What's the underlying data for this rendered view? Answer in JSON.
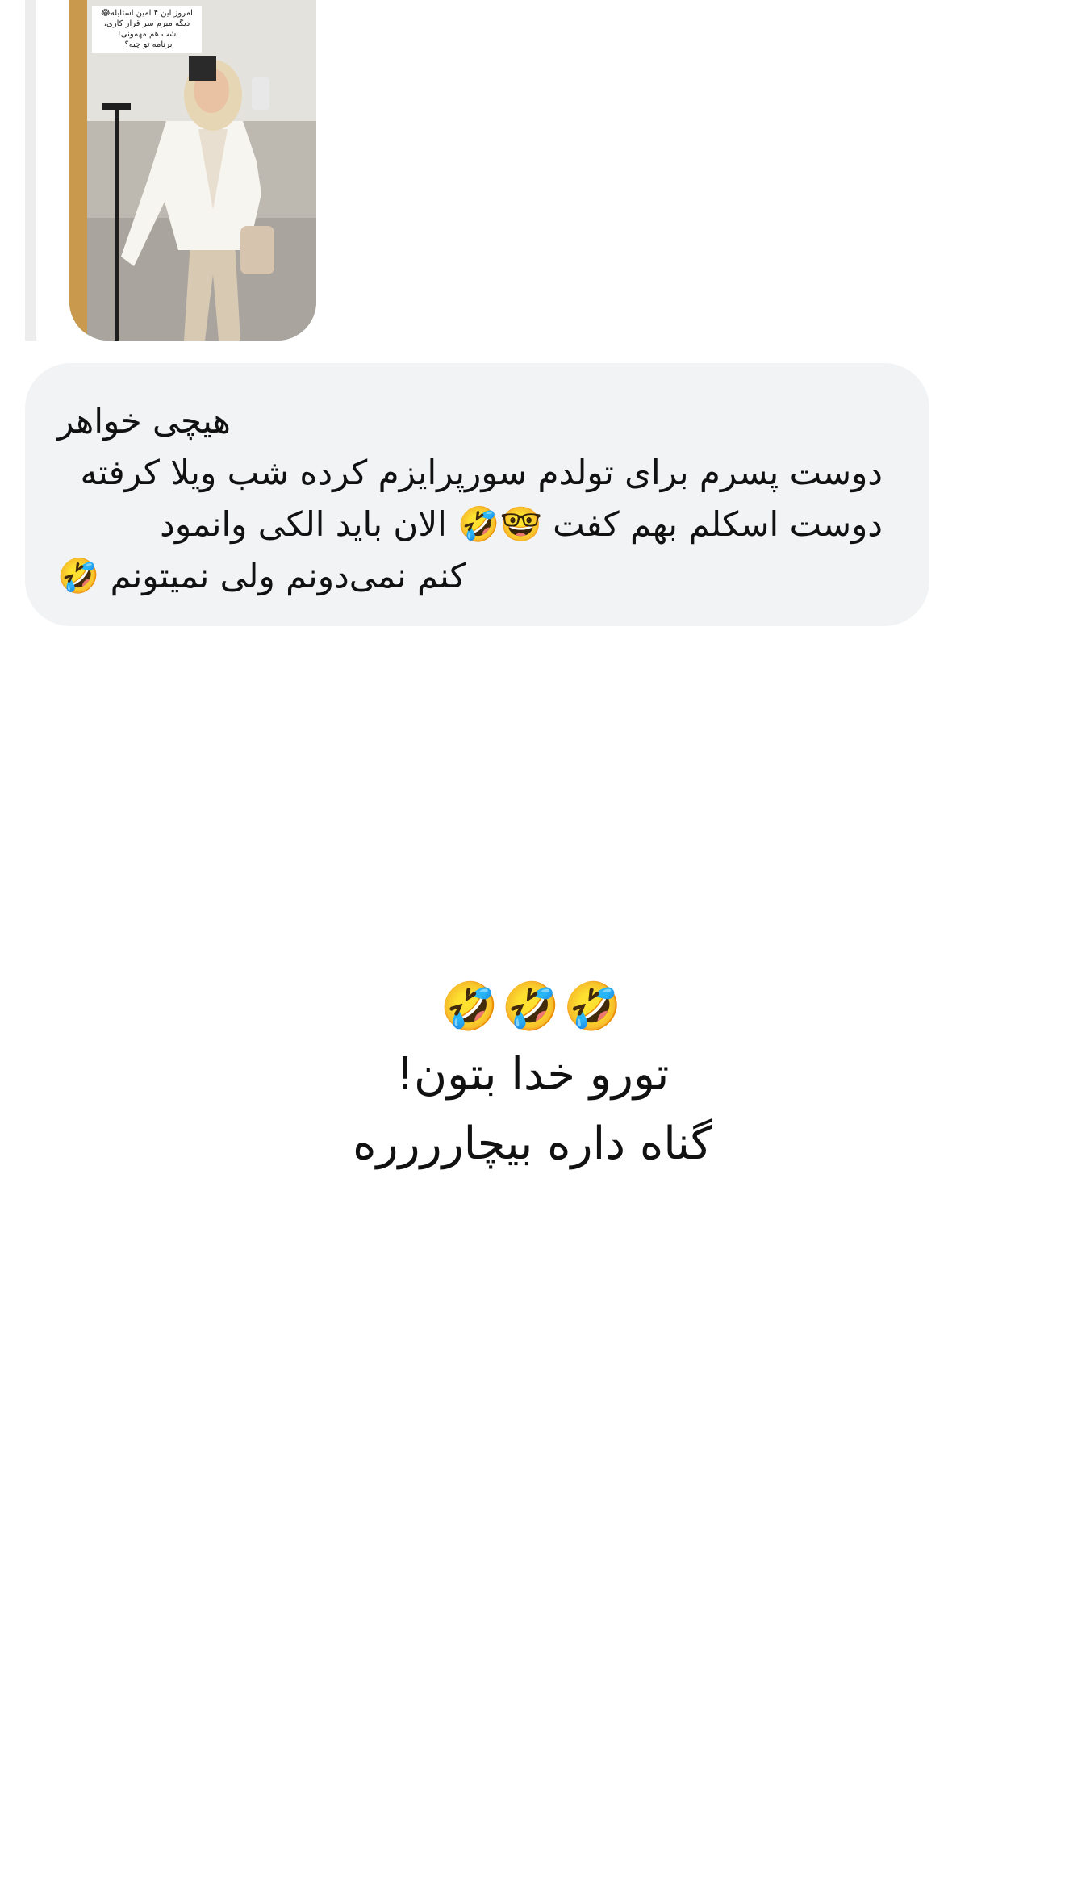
{
  "story_preview": {
    "caption_lines": [
      "امروز این ۴ امین استایله😂",
      "دیگه میرم سر قرار کاری،",
      "شب هم مهمونی!",
      "برنامه تو چیه؟!"
    ]
  },
  "received_message": {
    "lines": [
      "هیچی خواهر",
      "دوست پسرم برای تولدم سورپرایزم کرده شب ویلا کرفته",
      "دوست اسکلم بهم کفت 🤓🤣 الان باید الکی وانمود",
      "کنم نمی‌دونم ولی نمیتونم 🤣"
    ]
  },
  "sent_message": {
    "emoji_row": "🤣🤣🤣",
    "lines": [
      "تورو خدا بتون!",
      "گناه داره بیچارررره"
    ]
  }
}
